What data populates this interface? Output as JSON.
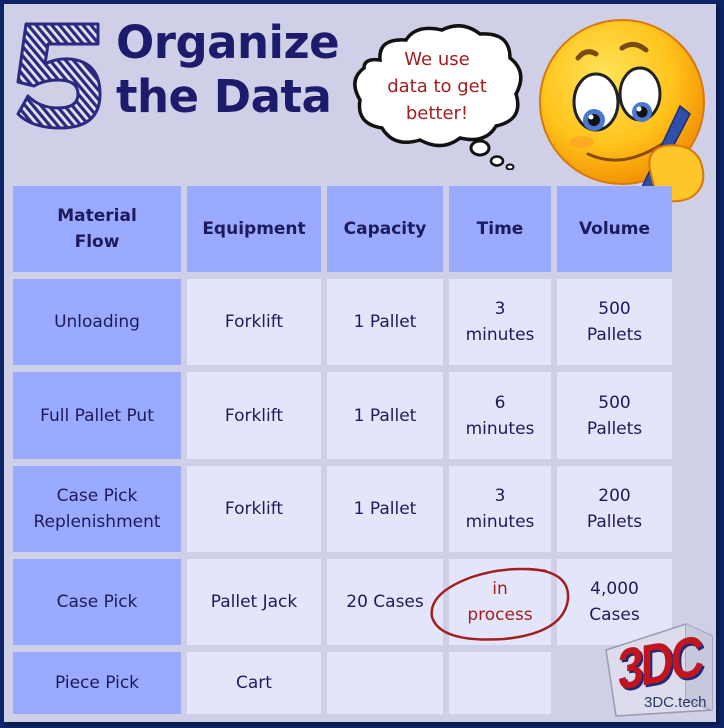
{
  "header": {
    "step_number": "5",
    "title_line1": "Organize",
    "title_line2": "the Data"
  },
  "speech_bubble": {
    "line1": "We use",
    "line2": "data to get",
    "line3": "better!"
  },
  "mascot": {
    "icon": "thinking-writing-emoji-icon"
  },
  "table": {
    "columns": [
      "Material\nFlow",
      "Equipment",
      "Capacity",
      "Time",
      "Volume"
    ],
    "rows": [
      {
        "flow": "Unloading",
        "equipment": "Forklift",
        "capacity": "1 Pallet",
        "time": "3\nminutes",
        "volume": "500\nPallets"
      },
      {
        "flow": "Full Pallet Put",
        "equipment": "Forklift",
        "capacity": "1 Pallet",
        "time": "6\nminutes",
        "volume": "500\nPallets"
      },
      {
        "flow": "Case Pick\nReplenishment",
        "equipment": "Forklift",
        "capacity": "1 Pallet",
        "time": "3\nminutes",
        "volume": "200\nPallets"
      },
      {
        "flow": "Case Pick",
        "equipment": "Pallet Jack",
        "capacity": "20 Cases",
        "time": "in\nprocess",
        "volume": "4,000\nCases"
      },
      {
        "flow": "Piece Pick",
        "equipment": "Cart",
        "capacity": "",
        "time": "",
        "volume": ""
      }
    ]
  },
  "annotation": {
    "highlighted_cell": "in process",
    "color": "#a31f1f"
  },
  "logo": {
    "mark": "3DC",
    "url": "3DC.tech"
  },
  "colors": {
    "frame": "#0d2466",
    "background": "#cfcfe8",
    "header_fill": "#99aaff",
    "cell_fill": "#e3e6fb",
    "text": "#1e1a5c",
    "title": "#1d1b6b",
    "accent_red": "#a31f1f"
  }
}
